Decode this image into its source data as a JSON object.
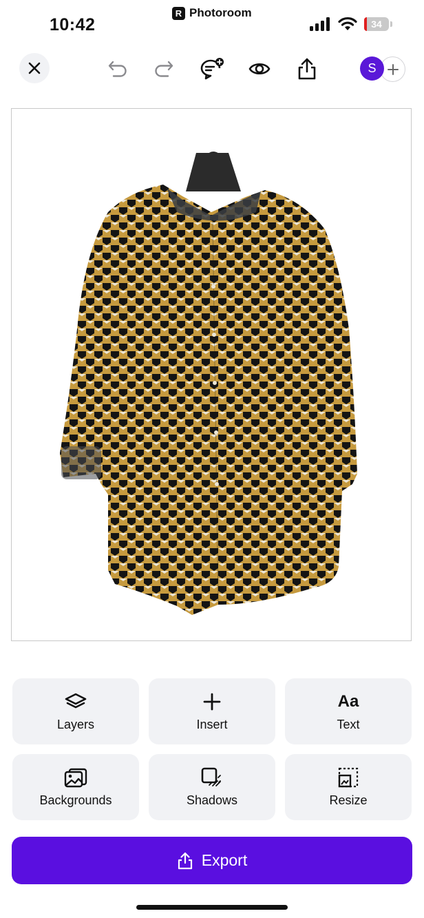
{
  "status_bar": {
    "time": "10:42",
    "app_name": "Photoroom",
    "app_logo_letter": "R",
    "battery_level": "34"
  },
  "toolbar": {
    "items": [
      {
        "name": "close-icon"
      },
      {
        "name": "undo-icon"
      },
      {
        "name": "redo-icon"
      },
      {
        "name": "comment-add-icon"
      },
      {
        "name": "eye-icon"
      },
      {
        "name": "share-icon"
      }
    ],
    "avatar_initial": "S",
    "add_collaborator_icon": "plus-icon"
  },
  "canvas": {
    "content": "shirt-image",
    "palette": {
      "base": "#c69a3e",
      "dark": "#141414",
      "light": "#ece6d6"
    }
  },
  "actions": [
    {
      "label": "Layers",
      "icon": "layers-icon"
    },
    {
      "label": "Insert",
      "icon": "plus-icon"
    },
    {
      "label": "Text",
      "icon": "text-icon",
      "glyph": "Aa"
    },
    {
      "label": "Backgrounds",
      "icon": "backgrounds-icon"
    },
    {
      "label": "Shadows",
      "icon": "shadows-icon"
    },
    {
      "label": "Resize",
      "icon": "resize-icon"
    }
  ],
  "export": {
    "label": "Export",
    "icon": "export-icon"
  },
  "colors": {
    "accent": "#5a0fe0",
    "tile_bg": "#f1f2f5",
    "avatar": "#5a18d8"
  }
}
